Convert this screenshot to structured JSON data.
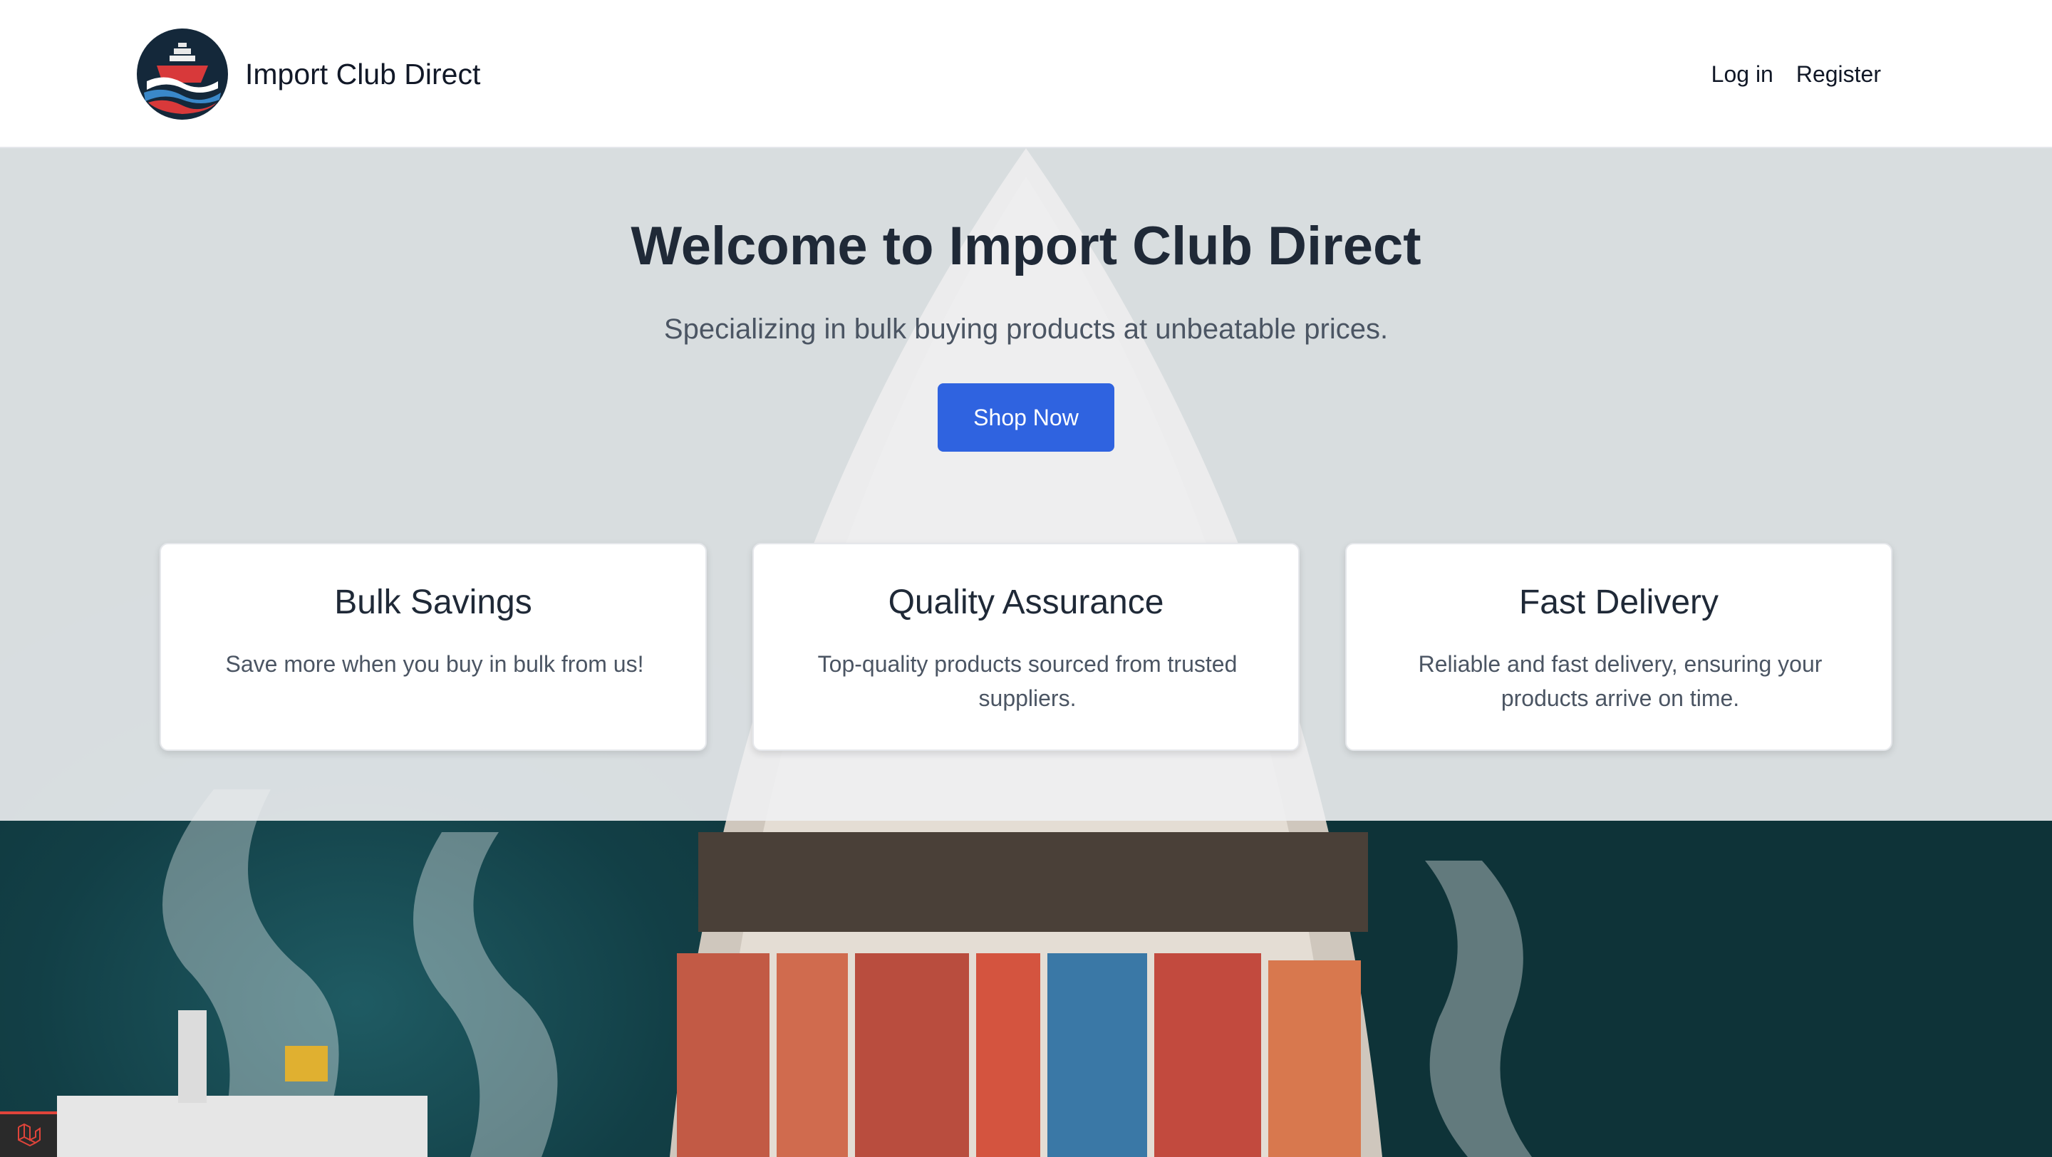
{
  "header": {
    "brand": "Import Club Direct",
    "nav": {
      "login": "Log in",
      "register": "Register"
    }
  },
  "hero": {
    "title": "Welcome to Import Club Direct",
    "subtitle": "Specializing in bulk buying products at unbeatable prices.",
    "cta": "Shop Now"
  },
  "features": [
    {
      "title": "Bulk Savings",
      "text": "Save more when you buy in bulk from us!"
    },
    {
      "title": "Quality Assurance",
      "text": "Top-quality products sourced from trusted suppliers."
    },
    {
      "title": "Fast Delivery",
      "text": "Reliable and fast delivery, ensuring your products arrive on time."
    }
  ],
  "colors": {
    "primary_button": "#2f63e0",
    "text_dark": "#1f2937",
    "text_muted": "#4b5563",
    "ocean": "#0f3a40",
    "badge_accent": "#e0443a"
  },
  "icons": {
    "logo": "ship-logo-icon",
    "badge": "laravel-icon"
  }
}
